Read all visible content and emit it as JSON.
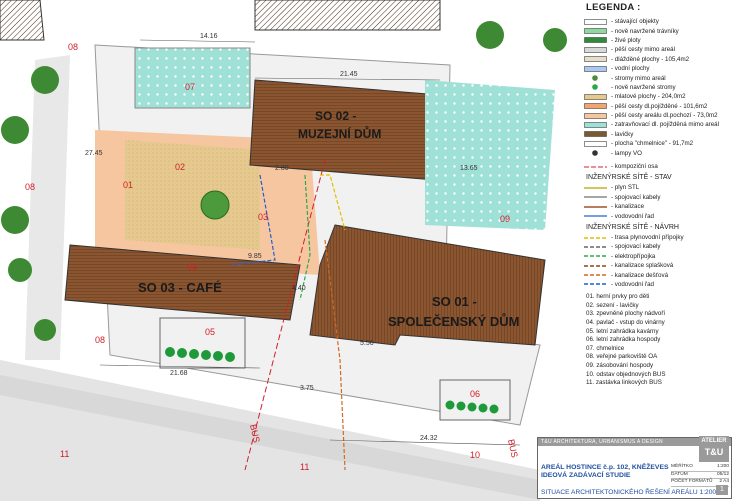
{
  "legend": {
    "title": "LEGENDA :",
    "items": [
      {
        "label": "- stávající objekty",
        "kind": "outline",
        "color": "#ffffff"
      },
      {
        "label": "- nově navržené trávníky",
        "kind": "fill",
        "color": "#8ed9a0"
      },
      {
        "label": "- živé ploty",
        "kind": "fill",
        "color": "#2e8b3a"
      },
      {
        "label": "- pěší cesty mimo areál",
        "kind": "fill",
        "color": "#d9d9d9"
      },
      {
        "label": "- dlážděné plochy - 105,4m2",
        "kind": "fill",
        "color": "#e8ddc8"
      },
      {
        "label": "- vodní plochy",
        "kind": "fill",
        "color": "#a9c9f2"
      },
      {
        "label": "- stromy mimo areál",
        "kind": "tree",
        "color": "#4c8a3c"
      },
      {
        "label": "- nově navržené stromy",
        "kind": "tree",
        "color": "#2aa84a"
      },
      {
        "label": "- mlatové plochy - 204,0m2",
        "kind": "fill",
        "color": "#e6c98e"
      },
      {
        "label": "- pěší cesty dl.pojížděné - 101,6m2",
        "kind": "fill",
        "color": "#f2a56f"
      },
      {
        "label": "- pěší cesty areálu dl.pochozí - 73,0m2",
        "kind": "fill",
        "color": "#f6c6a0"
      },
      {
        "label": "- zatravňovací dl. pojížděná mimo areál",
        "kind": "fill",
        "color": "#9fe0d7"
      },
      {
        "label": "- lavičky",
        "kind": "fill",
        "color": "#7a5a30"
      },
      {
        "label": "- plocha \"chmelnice\" - 91,7m2",
        "kind": "outline",
        "color": "#ffffff"
      },
      {
        "label": "- lampy VO",
        "kind": "lamp",
        "color": "#333333"
      }
    ],
    "axis_label": "- kompoziční osa",
    "sec_existing": "INŽENÝRSKÉ SÍTĚ - STAV",
    "existing": [
      {
        "label": "- plyn STL",
        "color": "#c9b227",
        "dash": ""
      },
      {
        "label": "- spojovací kabely",
        "color": "#888888",
        "dash": ""
      },
      {
        "label": "- kanalizace",
        "color": "#a0522d",
        "dash": ""
      },
      {
        "label": "- vodovodní řad",
        "color": "#4a7fd0",
        "dash": ""
      }
    ],
    "sec_new": "INŽENÝRSKÉ SÍTĚ - NÁVRH",
    "new": [
      {
        "label": "- trasa plynovodní přípojky",
        "color": "#e0c000",
        "dash": "4 2"
      },
      {
        "label": "- spojovací kabely",
        "color": "#666666",
        "dash": "4 2"
      },
      {
        "label": "- elektropřípojka",
        "color": "#2aa84a",
        "dash": "4 2"
      },
      {
        "label": "- kanalizace splašková",
        "color": "#8b4513",
        "dash": "4 2"
      },
      {
        "label": "- kanalizace dešťová",
        "color": "#d2691e",
        "dash": "4 2"
      },
      {
        "label": "- vodovodní řad",
        "color": "#1f5fd0",
        "dash": "4 2"
      }
    ],
    "numbered": [
      "01. herní prvky pro děti",
      "02. sezení - lavičky",
      "03. zpevněné plochy nádvoří",
      "04. pavlač - vstup do vinárny",
      "05. letní zahrádka kavárny",
      "06. letní zahrádka hospody",
      "07. chmelnice",
      "08. veřejné parkoviště OA",
      "09. zásobování hospody",
      "10. odstav objednových BUS",
      "11. zastávka linkových BUS"
    ]
  },
  "plan": {
    "buildings": [
      {
        "line1": "SO 02 -",
        "line2": "MUZEJNÍ DŮM"
      },
      {
        "line1": "SO 03 - CAFÉ",
        "line2": ""
      },
      {
        "line1": "SO 01 -",
        "line2": "SPOLEČENSKÝ DŮM"
      }
    ],
    "zones": [
      "01",
      "02",
      "03",
      "04",
      "05",
      "06",
      "07",
      "08",
      "08",
      "08",
      "09",
      "10",
      "11",
      "11"
    ],
    "dims": [
      "14.16",
      "21.45",
      "27.45",
      "13.65",
      "2.80",
      "9.85",
      "4.40",
      "21.68",
      "24.32",
      "3.75",
      "5.56"
    ],
    "bus": [
      "BUS",
      "BUS"
    ]
  },
  "titleblock": {
    "header": "T&U ARCHITEKTURA, URBANISMUS A DESIGN",
    "logo1": "ATELIER",
    "logo2": "T&U",
    "project1": "AREÁL HOSTINCE č.p. 102, KNĚŽEVES",
    "project2": "IDEOVÁ ZADÁVACÍ STUDIE",
    "drawing": "SITUACE ARCHITEKTONICKÉHO ŘEŠENÍ AREÁLU 1:200",
    "fields": [
      {
        "k": "MĚŘÍTKO",
        "v": "1:200"
      },
      {
        "k": "DATUM",
        "v": "05/12"
      },
      {
        "k": "POČET FORMÁTŮ",
        "v": "2 A4"
      }
    ],
    "sheet": "1"
  }
}
